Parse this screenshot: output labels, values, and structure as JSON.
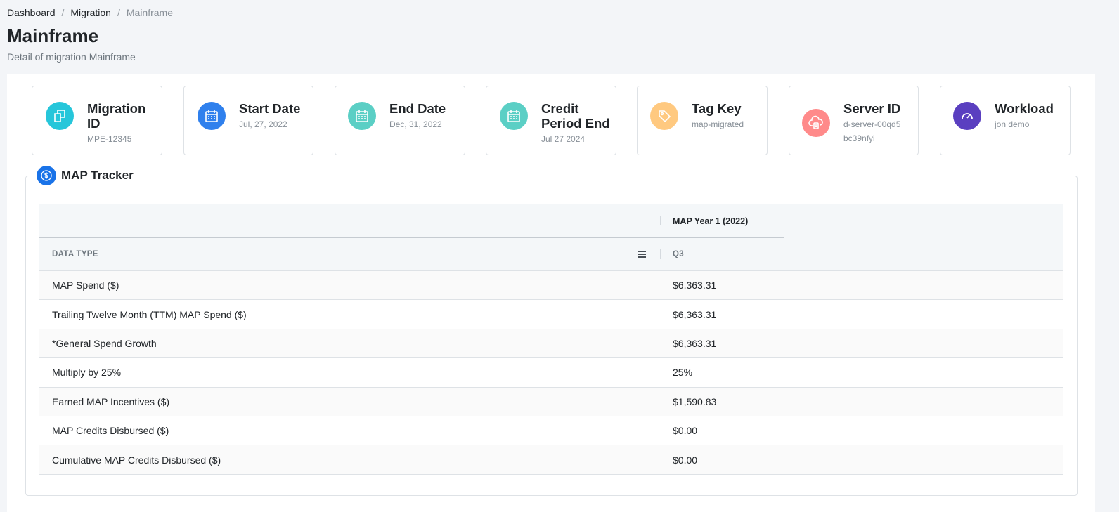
{
  "breadcrumb": {
    "items": [
      "Dashboard",
      "Migration"
    ],
    "current": "Mainframe",
    "separator": "/"
  },
  "page": {
    "title": "Mainframe",
    "subtitle": "Detail of migration Mainframe"
  },
  "cards": [
    {
      "title": "Migration ID",
      "value": "MPE-12345",
      "icon": "copy-icon",
      "color": "#26c6da"
    },
    {
      "title": "Start Date",
      "value": "Jul, 27, 2022",
      "icon": "calendar-icon",
      "color": "#2f80ed"
    },
    {
      "title": "End Date",
      "value": "Dec, 31, 2022",
      "icon": "calendar-icon",
      "color": "#5bcfc5"
    },
    {
      "title": "Credit Period End",
      "value": "Jul 27 2024",
      "icon": "calendar-icon",
      "color": "#5bcfc5"
    },
    {
      "title": "Tag Key",
      "value": "map-migrated",
      "icon": "tag-icon",
      "color": "#ffc980"
    },
    {
      "title": "Server ID",
      "value": "d-server-00qd5bc39nfyi",
      "icon": "cloud-server-icon",
      "color": "#ff8a8a"
    },
    {
      "title": "Workload",
      "value": "jon demo",
      "icon": "gauge-icon",
      "color": "#5a3fc0"
    }
  ],
  "tracker": {
    "title": "MAP Tracker",
    "icon": "dollar-coin-icon",
    "group_header": "MAP Year 1 (2022)",
    "columns": [
      "DATA TYPE",
      "Q3"
    ],
    "rows": [
      {
        "type": "MAP Spend ($)",
        "q3": "$6,363.31"
      },
      {
        "type": "Trailing Twelve Month (TTM) MAP Spend ($)",
        "q3": "$6,363.31"
      },
      {
        "type": "*General Spend Growth",
        "q3": "$6,363.31"
      },
      {
        "type": "Multiply by 25%",
        "q3": "25%"
      },
      {
        "type": "Earned MAP Incentives ($)",
        "q3": "$1,590.83"
      },
      {
        "type": "MAP Credits Disbursed ($)",
        "q3": "$0.00"
      },
      {
        "type": "Cumulative MAP Credits Disbursed ($)",
        "q3": "$0.00"
      }
    ]
  }
}
